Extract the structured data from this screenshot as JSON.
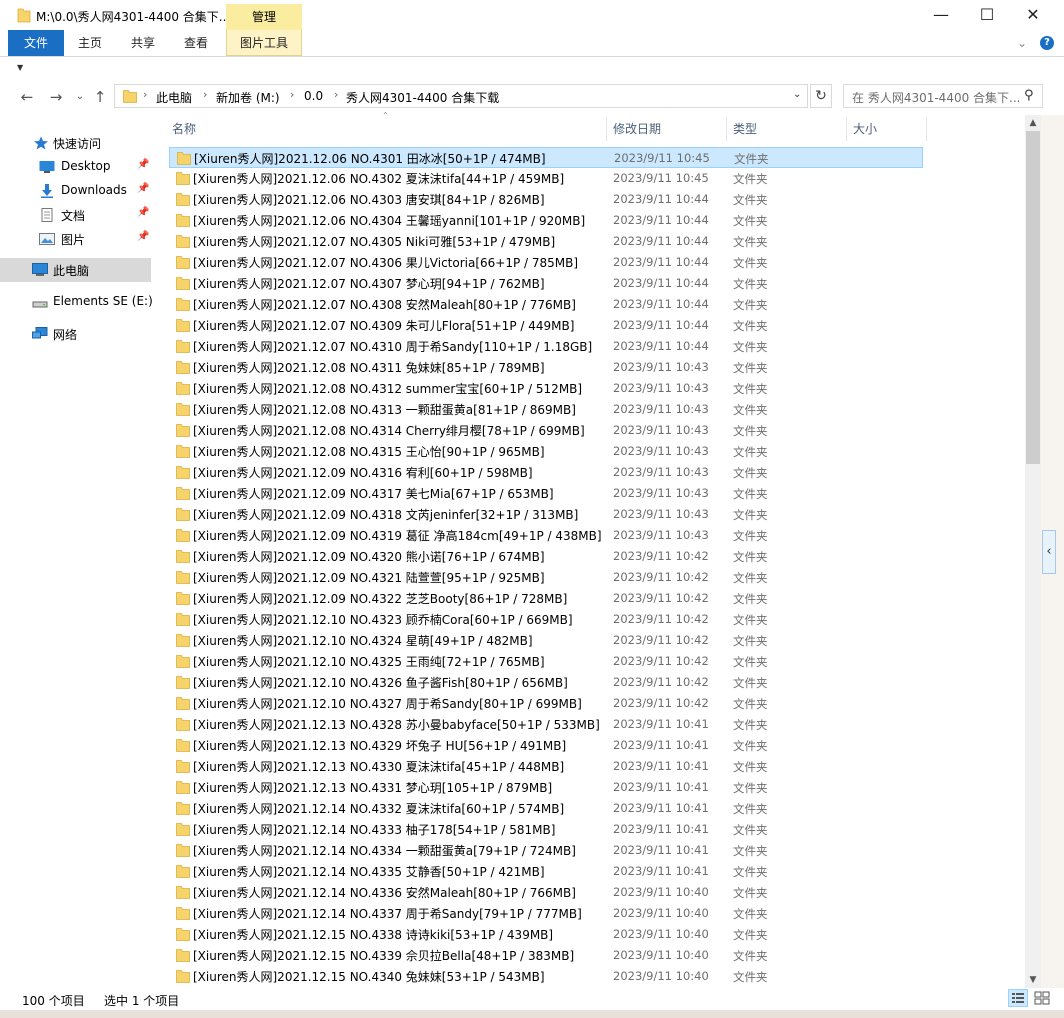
{
  "window": {
    "title": "M:\\0.0\\秀人网4301-4400 合集下...",
    "manage_tab": "管理",
    "minimize": "—",
    "maximize": "☐",
    "close": "✕"
  },
  "ribbon": {
    "tabs": [
      "文件",
      "主页",
      "共享",
      "查看",
      "图片工具"
    ],
    "expand_icon": "chevron-down-icon",
    "help_icon": "help-icon"
  },
  "address": {
    "breadcrumbs": [
      "此电脑",
      "新加卷 (M:)",
      "0.0",
      "秀人网4301-4400 合集下载"
    ],
    "search_placeholder": "在 秀人网4301-4400 合集下...",
    "search_icon": "search-icon"
  },
  "nav": {
    "quick_access": "快速访问",
    "pinned": [
      "Desktop",
      "Downloads",
      "文档",
      "图片"
    ],
    "this_pc": "此电脑",
    "drive": "Elements SE (E:)",
    "network": "网络"
  },
  "columns": [
    "名称",
    "修改日期",
    "类型",
    "大小"
  ],
  "files": [
    {
      "name": "[Xiuren秀人网]2021.12.06 NO.4301 田冰冰[50+1P / 474MB]",
      "date": "2023/9/11 10:45",
      "type": "文件夹",
      "selected": true
    },
    {
      "name": "[Xiuren秀人网]2021.12.06 NO.4302 夏沫沫tifa[44+1P / 459MB]",
      "date": "2023/9/11 10:45",
      "type": "文件夹"
    },
    {
      "name": "[Xiuren秀人网]2021.12.06 NO.4303 唐安琪[84+1P / 826MB]",
      "date": "2023/9/11 10:44",
      "type": "文件夹"
    },
    {
      "name": "[Xiuren秀人网]2021.12.06 NO.4304 王馨瑶yanni[101+1P / 920MB]",
      "date": "2023/9/11 10:44",
      "type": "文件夹"
    },
    {
      "name": "[Xiuren秀人网]2021.12.07 NO.4305 Niki可雅[53+1P / 479MB]",
      "date": "2023/9/11 10:44",
      "type": "文件夹"
    },
    {
      "name": "[Xiuren秀人网]2021.12.07 NO.4306 果儿Victoria[66+1P / 785MB]",
      "date": "2023/9/11 10:44",
      "type": "文件夹"
    },
    {
      "name": "[Xiuren秀人网]2021.12.07 NO.4307 梦心玥[94+1P / 762MB]",
      "date": "2023/9/11 10:44",
      "type": "文件夹"
    },
    {
      "name": "[Xiuren秀人网]2021.12.07 NO.4308 安然Maleah[80+1P / 776MB]",
      "date": "2023/9/11 10:44",
      "type": "文件夹"
    },
    {
      "name": "[Xiuren秀人网]2021.12.07 NO.4309 朱可儿Flora[51+1P / 449MB]",
      "date": "2023/9/11 10:44",
      "type": "文件夹"
    },
    {
      "name": "[Xiuren秀人网]2021.12.07 NO.4310 周于希Sandy[110+1P / 1.18GB]",
      "date": "2023/9/11 10:44",
      "type": "文件夹"
    },
    {
      "name": "[Xiuren秀人网]2021.12.08 NO.4311 兔妹妹[85+1P / 789MB]",
      "date": "2023/9/11 10:43",
      "type": "文件夹"
    },
    {
      "name": "[Xiuren秀人网]2021.12.08 NO.4312 summer宝宝[60+1P / 512MB]",
      "date": "2023/9/11 10:43",
      "type": "文件夹"
    },
    {
      "name": "[Xiuren秀人网]2021.12.08 NO.4313 一颗甜蛋黄a[81+1P / 869MB]",
      "date": "2023/9/11 10:43",
      "type": "文件夹"
    },
    {
      "name": "[Xiuren秀人网]2021.12.08 NO.4314 Cherry绯月樱[78+1P / 699MB]",
      "date": "2023/9/11 10:43",
      "type": "文件夹"
    },
    {
      "name": "[Xiuren秀人网]2021.12.08 NO.4315 王心怡[90+1P / 965MB]",
      "date": "2023/9/11 10:43",
      "type": "文件夹"
    },
    {
      "name": "[Xiuren秀人网]2021.12.09 NO.4316 宥利[60+1P / 598MB]",
      "date": "2023/9/11 10:43",
      "type": "文件夹"
    },
    {
      "name": "[Xiuren秀人网]2021.12.09 NO.4317 美七Mia[67+1P / 653MB]",
      "date": "2023/9/11 10:43",
      "type": "文件夹"
    },
    {
      "name": "[Xiuren秀人网]2021.12.09 NO.4318 文芮jeninfer[32+1P / 313MB]",
      "date": "2023/9/11 10:43",
      "type": "文件夹"
    },
    {
      "name": "[Xiuren秀人网]2021.12.09 NO.4319 葛征 净高184cm[49+1P / 438MB]",
      "date": "2023/9/11 10:43",
      "type": "文件夹"
    },
    {
      "name": "[Xiuren秀人网]2021.12.09 NO.4320 熊小诺[76+1P / 674MB]",
      "date": "2023/9/11 10:42",
      "type": "文件夹"
    },
    {
      "name": "[Xiuren秀人网]2021.12.09 NO.4321 陆萱萱[95+1P / 925MB]",
      "date": "2023/9/11 10:42",
      "type": "文件夹"
    },
    {
      "name": "[Xiuren秀人网]2021.12.09 NO.4322 芝芝Booty[86+1P / 728MB]",
      "date": "2023/9/11 10:42",
      "type": "文件夹"
    },
    {
      "name": "[Xiuren秀人网]2021.12.10 NO.4323 顾乔楠Cora[60+1P / 669MB]",
      "date": "2023/9/11 10:42",
      "type": "文件夹"
    },
    {
      "name": "[Xiuren秀人网]2021.12.10 NO.4324 星萌[49+1P / 482MB]",
      "date": "2023/9/11 10:42",
      "type": "文件夹"
    },
    {
      "name": "[Xiuren秀人网]2021.12.10 NO.4325 王雨纯[72+1P / 765MB]",
      "date": "2023/9/11 10:42",
      "type": "文件夹"
    },
    {
      "name": "[Xiuren秀人网]2021.12.10 NO.4326 鱼子酱Fish[80+1P / 656MB]",
      "date": "2023/9/11 10:42",
      "type": "文件夹"
    },
    {
      "name": "[Xiuren秀人网]2021.12.10 NO.4327 周于希Sandy[80+1P / 699MB]",
      "date": "2023/9/11 10:42",
      "type": "文件夹"
    },
    {
      "name": "[Xiuren秀人网]2021.12.13 NO.4328 苏小曼babyface[50+1P / 533MB]",
      "date": "2023/9/11 10:41",
      "type": "文件夹"
    },
    {
      "name": "[Xiuren秀人网]2021.12.13 NO.4329 坏兔子 HU[56+1P / 491MB]",
      "date": "2023/9/11 10:41",
      "type": "文件夹"
    },
    {
      "name": "[Xiuren秀人网]2021.12.13 NO.4330 夏沫沫tifa[45+1P / 448MB]",
      "date": "2023/9/11 10:41",
      "type": "文件夹"
    },
    {
      "name": "[Xiuren秀人网]2021.12.13 NO.4331 梦心玥[105+1P / 879MB]",
      "date": "2023/9/11 10:41",
      "type": "文件夹"
    },
    {
      "name": "[Xiuren秀人网]2021.12.14 NO.4332 夏沫沫tifa[60+1P / 574MB]",
      "date": "2023/9/11 10:41",
      "type": "文件夹"
    },
    {
      "name": "[Xiuren秀人网]2021.12.14 NO.4333 柚子178[54+1P / 581MB]",
      "date": "2023/9/11 10:41",
      "type": "文件夹"
    },
    {
      "name": "[Xiuren秀人网]2021.12.14 NO.4334 一颗甜蛋黄a[79+1P / 724MB]",
      "date": "2023/9/11 10:41",
      "type": "文件夹"
    },
    {
      "name": "[Xiuren秀人网]2021.12.14 NO.4335 艾静香[50+1P / 421MB]",
      "date": "2023/9/11 10:41",
      "type": "文件夹"
    },
    {
      "name": "[Xiuren秀人网]2021.12.14 NO.4336 安然Maleah[80+1P / 766MB]",
      "date": "2023/9/11 10:40",
      "type": "文件夹"
    },
    {
      "name": "[Xiuren秀人网]2021.12.14 NO.4337 周于希Sandy[79+1P / 777MB]",
      "date": "2023/9/11 10:40",
      "type": "文件夹"
    },
    {
      "name": "[Xiuren秀人网]2021.12.15 NO.4338 诗诗kiki[53+1P / 439MB]",
      "date": "2023/9/11 10:40",
      "type": "文件夹"
    },
    {
      "name": "[Xiuren秀人网]2021.12.15 NO.4339 佘贝拉Bella[48+1P / 383MB]",
      "date": "2023/9/11 10:40",
      "type": "文件夹"
    },
    {
      "name": "[Xiuren秀人网]2021.12.15 NO.4340 兔妹妹[53+1P / 543MB]",
      "date": "2023/9/11 10:40",
      "type": "文件夹"
    }
  ],
  "status": {
    "item_count": "100 个项目",
    "selected": "选中 1 个项目"
  },
  "colors": {
    "file_tab": "#1a6fc4",
    "manage_tab": "#fbeda0",
    "selection": "#cce8ff",
    "folder": "#f7d36b"
  }
}
